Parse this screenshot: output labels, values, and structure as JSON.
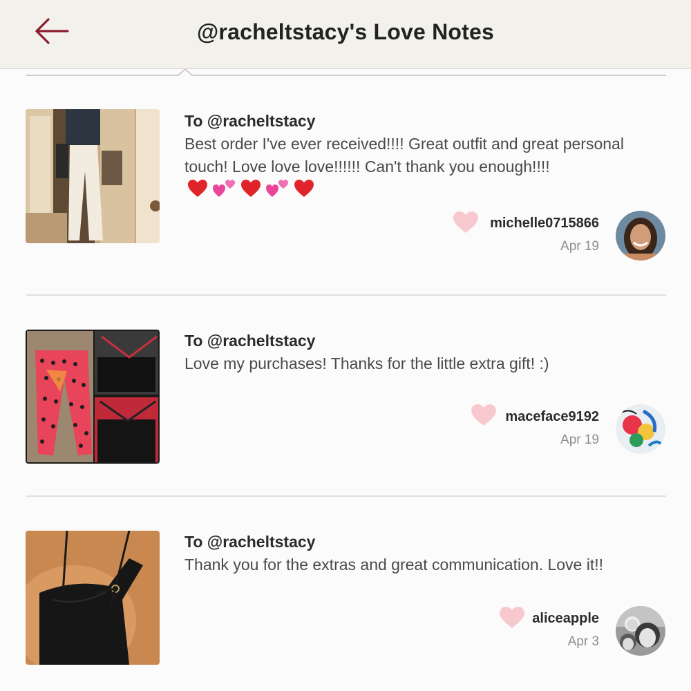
{
  "header": {
    "title": "@racheltstacy's Love Notes",
    "back_icon": "arrow-left-icon"
  },
  "notes": [
    {
      "to": "To @racheltstacy",
      "body": "Best order I've ever received!!!! Great outfit and great personal touch! Love love love!!!!!! Can't thank you enough!!!!",
      "emojis": [
        "red-heart",
        "two-hearts",
        "red-heart",
        "two-hearts",
        "red-heart"
      ],
      "author": "michelle0715866",
      "date": "Apr 19"
    },
    {
      "to": "To @racheltstacy",
      "body": "Love my purchases! Thanks for the little extra gift! :)",
      "author": "maceface9192",
      "date": "Apr 19"
    },
    {
      "to": "To @racheltstacy",
      "body": "Thank you for the extras and great communication. Love it!!",
      "author": "aliceapple",
      "date": "Apr 3"
    }
  ],
  "colors": {
    "accent": "#8b1d2c",
    "heart": "#f7c9cf",
    "header_bg": "#f3f1ec"
  }
}
